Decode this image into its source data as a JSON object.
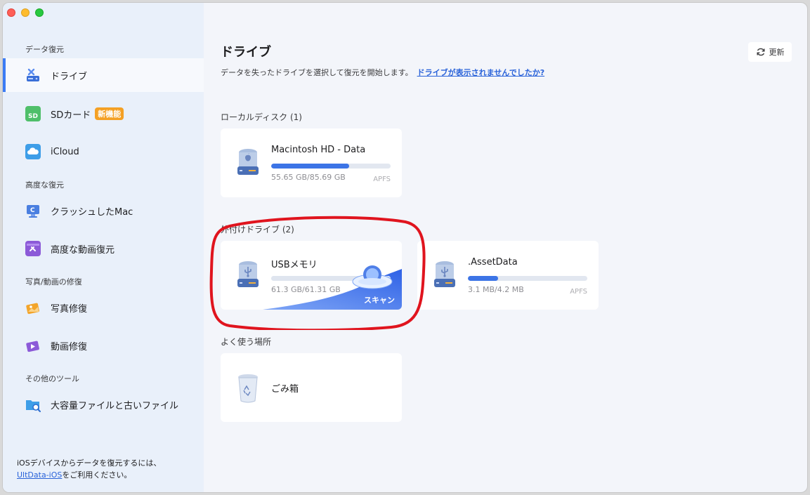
{
  "window": {
    "title": ""
  },
  "sidebar": {
    "sections": [
      {
        "label": "データ復元",
        "items": [
          {
            "label": "ドライブ",
            "icon": "drive-tools-icon",
            "active": true
          },
          {
            "label": "SDカード",
            "icon": "sd-card-icon",
            "badge": "新機能"
          },
          {
            "label": "iCloud",
            "icon": "icloud-icon"
          }
        ]
      },
      {
        "label": "高度な復元",
        "items": [
          {
            "label": "クラッシュしたMac",
            "icon": "crashed-mac-icon"
          },
          {
            "label": "高度な動画復元",
            "icon": "video-recovery-icon"
          }
        ]
      },
      {
        "label": "写真/動画の修復",
        "items": [
          {
            "label": "写真修復",
            "icon": "photo-repair-icon"
          },
          {
            "label": "動画修復",
            "icon": "video-repair-icon"
          }
        ]
      },
      {
        "label": "その他のツール",
        "items": [
          {
            "label": "大容量ファイルと古いファイル",
            "icon": "large-files-icon"
          }
        ]
      }
    ],
    "footer": {
      "line1": "iOSデバイスからデータを復元するには、",
      "link": "UltData-iOS",
      "line2_suffix": "をご利用ください。"
    }
  },
  "main": {
    "title": "ドライブ",
    "subtitle": "データを失ったドライブを選択して復元を開始します。",
    "help_link": "ドライブが表示されませんでしたか?",
    "refresh_label": "更新",
    "groups": [
      {
        "label": "ローカルディスク (1)",
        "drives": [
          {
            "name": "Macintosh HD - Data",
            "size": "55.65 GB/85.69 GB",
            "fs": "APFS",
            "usage": 0.65,
            "icon": "internal-drive-icon"
          }
        ]
      },
      {
        "label": "外付けドライブ (2)",
        "drives": [
          {
            "name": "USBメモリ",
            "size": "61.3 GB/61.31 GB",
            "usage": 1.0,
            "icon": "usb-drive-icon",
            "hover_action": "スキャン"
          },
          {
            "name": ".AssetData",
            "size": "3.1 MB/4.2 MB",
            "fs": "APFS",
            "usage": 0.25,
            "icon": "usb-drive-icon"
          }
        ]
      },
      {
        "label": "よく使う場所",
        "drives": [
          {
            "name": "ごみ箱",
            "icon": "trash-icon"
          }
        ]
      }
    ]
  },
  "colors": {
    "accent": "#3c74e6",
    "highlight": "#e0141e",
    "badge": "#f4a024"
  }
}
